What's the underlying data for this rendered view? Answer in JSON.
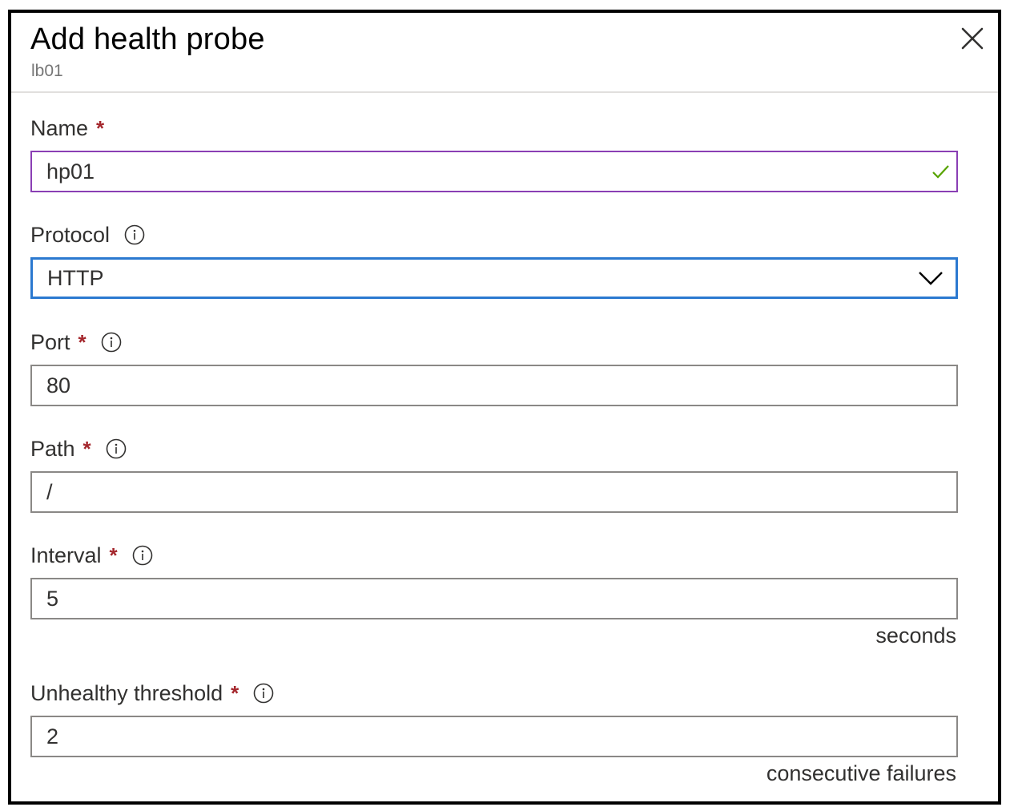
{
  "header": {
    "title": "Add health probe",
    "subtitle": "lb01"
  },
  "icons": {
    "close": "close-icon",
    "info": "info-icon",
    "check": "check-icon",
    "chevron": "chevron-down-icon"
  },
  "colors": {
    "required": "#a4262c",
    "valid_border": "#8a3fb4",
    "valid_check": "#57a300",
    "focus_border": "#2b79d0"
  },
  "fields": {
    "name": {
      "label": "Name",
      "required": "*",
      "value": "hp01",
      "state": "valid"
    },
    "protocol": {
      "label": "Protocol",
      "value": "HTTP"
    },
    "port": {
      "label": "Port",
      "required": "*",
      "value": "80"
    },
    "path": {
      "label": "Path",
      "required": "*",
      "value": "/"
    },
    "interval": {
      "label": "Interval",
      "required": "*",
      "value": "5",
      "unit": "seconds"
    },
    "unhealthy_threshold": {
      "label": "Unhealthy threshold",
      "required": "*",
      "value": "2",
      "unit": "consecutive failures"
    }
  }
}
